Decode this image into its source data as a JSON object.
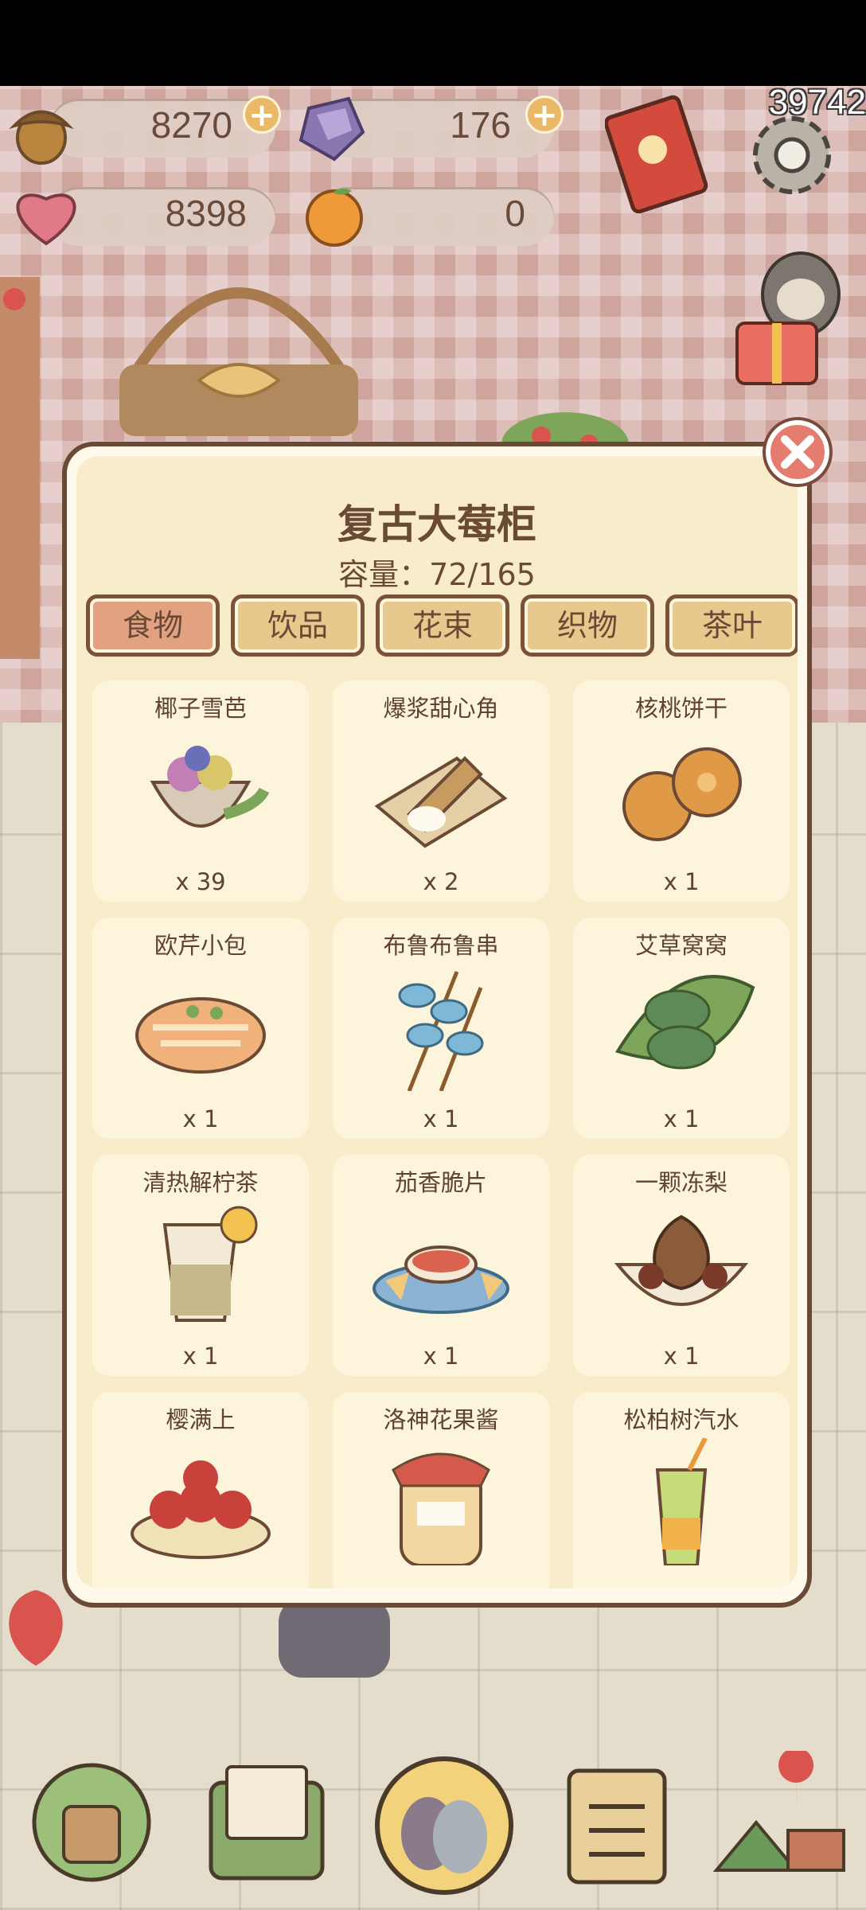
{
  "hud": {
    "acorns": "8270",
    "gems": "176",
    "hearts": "8398",
    "oranges": "0",
    "score": "39742"
  },
  "icons": {
    "acorn": "acorn-icon",
    "gem": "purple-gem-icon",
    "heart": "heart-icon",
    "orange": "orange-icon",
    "book": "recipe-book-icon",
    "settings": "gear-icon",
    "gift": "gift-sloth-icon",
    "close": "close-icon"
  },
  "panel": {
    "title": "复古大莓柜",
    "capacity": "容量：72/165",
    "tabs": [
      {
        "label": "食物",
        "active": true
      },
      {
        "label": "饮品",
        "active": false
      },
      {
        "label": "花束",
        "active": false
      },
      {
        "label": "织物",
        "active": false
      },
      {
        "label": "茶叶",
        "active": false
      }
    ],
    "items": [
      {
        "name": "椰子雪芭",
        "count": "x 39"
      },
      {
        "name": "爆浆甜心角",
        "count": "x 2"
      },
      {
        "name": "核桃饼干",
        "count": "x 1"
      },
      {
        "name": "欧芹小包",
        "count": "x 1"
      },
      {
        "name": "布鲁布鲁串",
        "count": "x 1"
      },
      {
        "name": "艾草窝窝",
        "count": "x 1"
      },
      {
        "name": "清热解柠茶",
        "count": "x 1"
      },
      {
        "name": "茄香脆片",
        "count": "x 1"
      },
      {
        "name": "一颗冻梨",
        "count": "x 1"
      },
      {
        "name": "樱满上",
        "count": ""
      },
      {
        "name": "洛神花果酱",
        "count": ""
      },
      {
        "name": "松柏树汽水",
        "count": ""
      }
    ]
  },
  "nav": [
    "house-icon",
    "mail-icon",
    "friends-icon",
    "tasks-icon",
    "map-icon"
  ],
  "colors": {
    "panel_border": "#6b4a35",
    "panel_bg": "#f8ecca",
    "tab_active": "#e2a282",
    "tab": "#e8c98d",
    "close": "#e47d6f"
  }
}
